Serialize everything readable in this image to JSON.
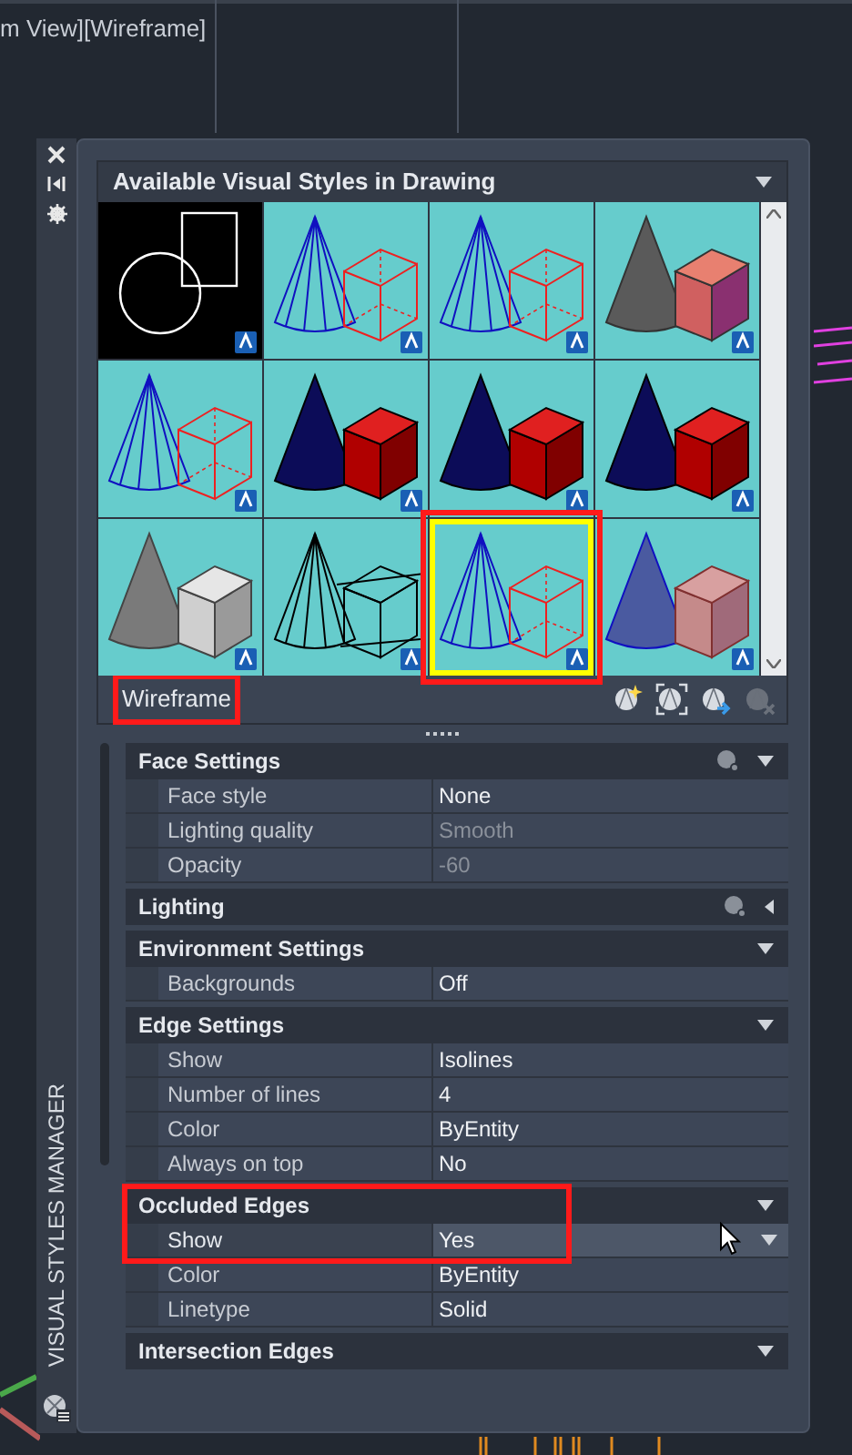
{
  "viewport": {
    "label": "m View][Wireframe]"
  },
  "palette": {
    "title": "VISUAL STYLES MANAGER"
  },
  "styles": {
    "title": "Available Visual Styles in Drawing",
    "items": [
      {
        "kind": "plain",
        "selected": false,
        "highlighted": false
      },
      {
        "kind": "wireframe",
        "selected": false,
        "highlighted": false
      },
      {
        "kind": "wireframe",
        "selected": false,
        "highlighted": false
      },
      {
        "kind": "realistic",
        "selected": false,
        "highlighted": false
      },
      {
        "kind": "wireframe",
        "selected": false,
        "highlighted": false
      },
      {
        "kind": "shaded",
        "selected": false,
        "highlighted": false
      },
      {
        "kind": "shaded",
        "selected": false,
        "highlighted": false
      },
      {
        "kind": "shaded",
        "selected": false,
        "highlighted": false
      },
      {
        "kind": "gray",
        "selected": false,
        "highlighted": false
      },
      {
        "kind": "sketch",
        "selected": false,
        "highlighted": false
      },
      {
        "kind": "wireframe",
        "selected": true,
        "highlighted": true
      },
      {
        "kind": "xray",
        "selected": false,
        "highlighted": false
      }
    ],
    "current_name": "Wireframe",
    "name_highlighted": true,
    "tools": [
      {
        "kind": "new",
        "disabled": false
      },
      {
        "kind": "apply",
        "disabled": false
      },
      {
        "kind": "export",
        "disabled": false
      },
      {
        "kind": "delete",
        "disabled": true
      }
    ]
  },
  "sections": [
    {
      "title": "Face Settings",
      "expanded": true,
      "light_icon": true,
      "highlighted": false,
      "rows": [
        {
          "label": "Face style",
          "value": "None",
          "disabled": false,
          "selected": false
        },
        {
          "label": "Lighting quality",
          "value": "Smooth",
          "disabled": true,
          "selected": false
        },
        {
          "label": "Opacity",
          "value": "-60",
          "disabled": true,
          "selected": false
        }
      ]
    },
    {
      "title": "Lighting",
      "expanded": false,
      "light_icon": true,
      "highlighted": false
    },
    {
      "title": "Environment Settings",
      "expanded": true,
      "light_icon": false,
      "highlighted": false,
      "rows": [
        {
          "label": "Backgrounds",
          "value": "Off",
          "disabled": false,
          "selected": false
        }
      ]
    },
    {
      "title": "Edge Settings",
      "expanded": true,
      "light_icon": false,
      "highlighted": false,
      "rows": [
        {
          "label": "Show",
          "value": "Isolines",
          "disabled": false,
          "selected": false
        },
        {
          "label": "Number of lines",
          "value": "4",
          "disabled": false,
          "selected": false
        },
        {
          "label": "Color",
          "value": "ByEntity",
          "disabled": false,
          "selected": false
        },
        {
          "label": "Always on top",
          "value": "No",
          "disabled": false,
          "selected": false
        }
      ]
    },
    {
      "title": "Occluded Edges",
      "expanded": true,
      "light_icon": false,
      "highlighted": true,
      "rows": [
        {
          "label": "Show",
          "value": "Yes",
          "disabled": false,
          "selected": true
        },
        {
          "label": "Color",
          "value": "ByEntity",
          "disabled": false,
          "selected": false
        },
        {
          "label": "Linetype",
          "value": "Solid",
          "disabled": false,
          "selected": false
        }
      ]
    },
    {
      "title": "Intersection Edges",
      "expanded": true,
      "light_icon": false,
      "highlighted": false
    }
  ]
}
